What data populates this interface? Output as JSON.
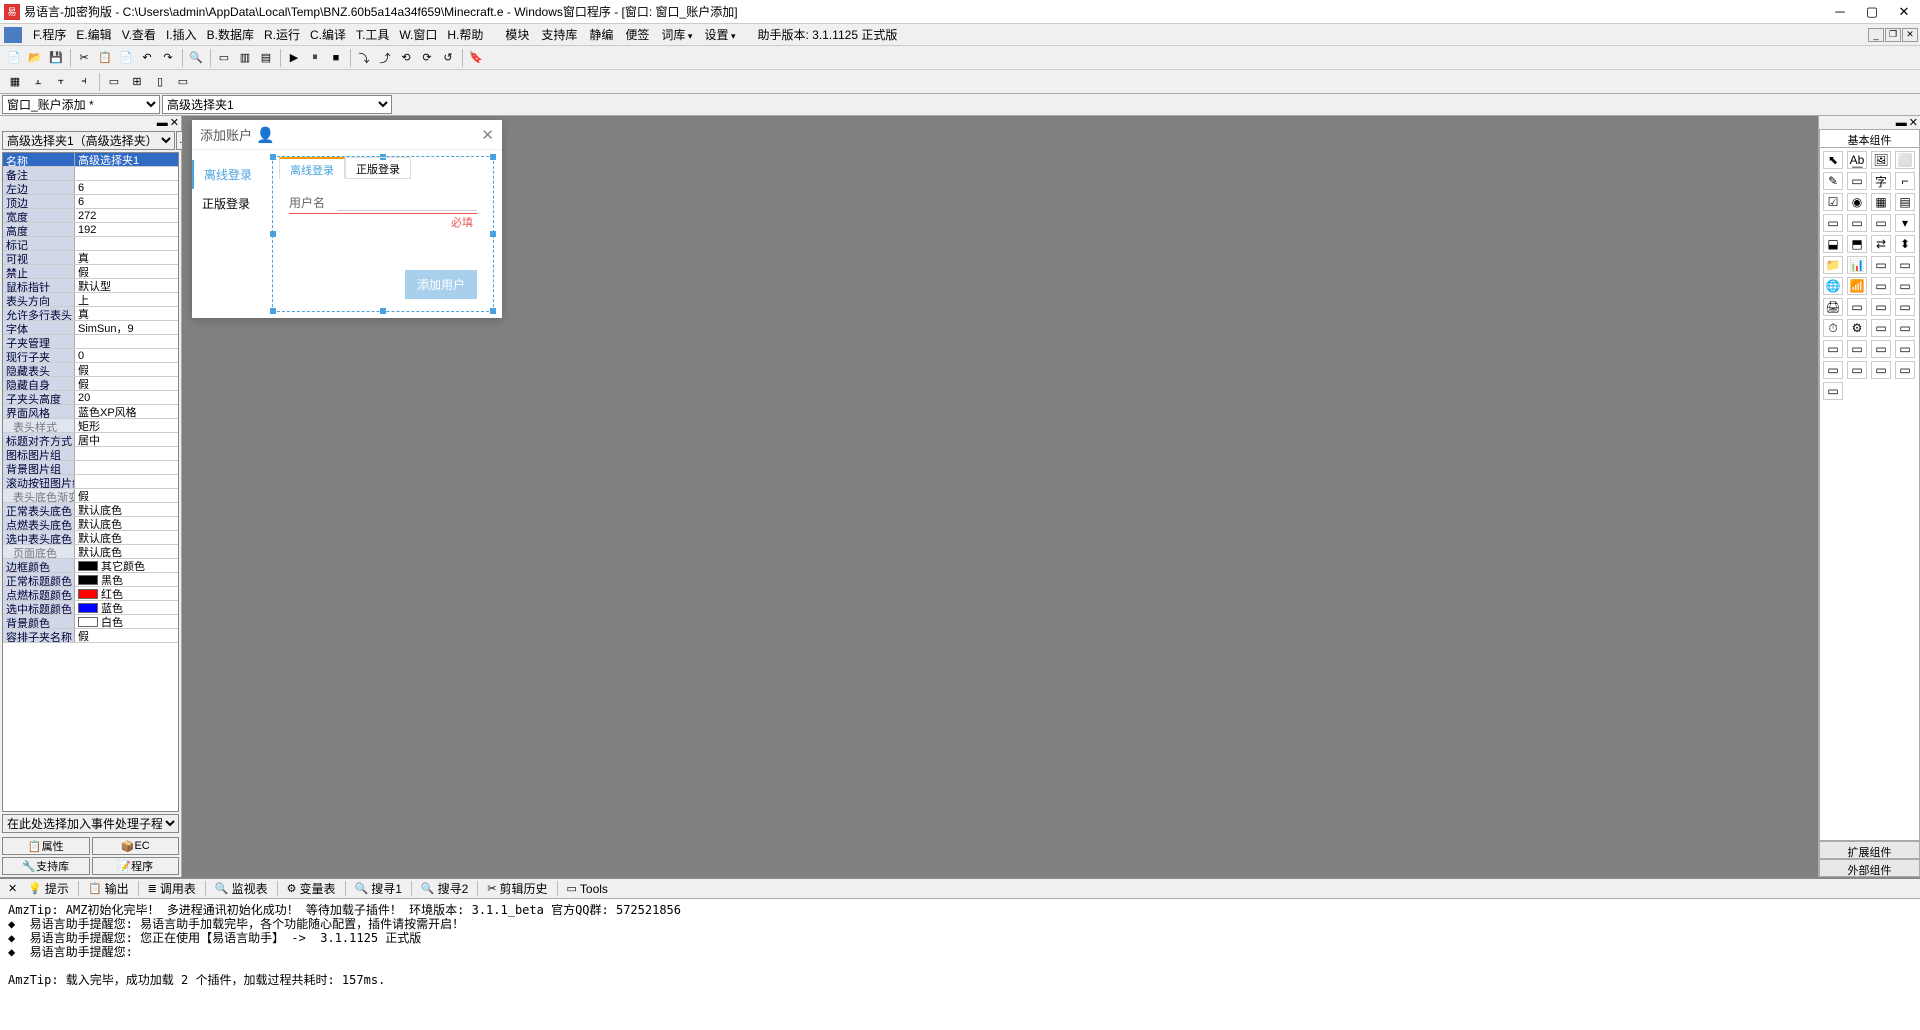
{
  "window": {
    "title": "易语言-加密狗版 - C:\\Users\\admin\\AppData\\Local\\Temp\\BNZ.60b5a14a34f659\\Minecraft.e - Windows窗口程序 - [窗口: 窗口_账户添加]"
  },
  "menu": {
    "items": [
      "F.程序",
      "E.编辑",
      "V.查看",
      "I.插入",
      "B.数据库",
      "R.运行",
      "C.编译",
      "T.工具",
      "W.窗口",
      "H.帮助"
    ],
    "items2": [
      "模块",
      "支持库",
      "静编",
      "便签",
      "词库",
      "设置"
    ],
    "helper_version": "助手版本: 3.1.1125 正式版"
  },
  "combo": {
    "left": "窗口_账户添加 *",
    "right": "高级选择夹1"
  },
  "props": {
    "selector": "高级选择夹1（高级选择夹）",
    "rows": [
      {
        "k": "名称",
        "v": "高级选择夹1",
        "sel": true
      },
      {
        "k": "备注",
        "v": ""
      },
      {
        "k": "左边",
        "v": "6"
      },
      {
        "k": "顶边",
        "v": "6"
      },
      {
        "k": "宽度",
        "v": "272"
      },
      {
        "k": "高度",
        "v": "192"
      },
      {
        "k": "标记",
        "v": ""
      },
      {
        "k": "可视",
        "v": "真"
      },
      {
        "k": "禁止",
        "v": "假"
      },
      {
        "k": "鼠标指针",
        "v": "默认型"
      },
      {
        "k": "表头方向",
        "v": "上"
      },
      {
        "k": "允许多行表头",
        "v": "真"
      },
      {
        "k": "字体",
        "v": "SimSun，9"
      },
      {
        "k": "子夹管理",
        "v": ""
      },
      {
        "k": "现行子夹",
        "v": "0"
      },
      {
        "k": "隐藏表头",
        "v": "假"
      },
      {
        "k": "隐藏自身",
        "v": "假"
      },
      {
        "k": "子夹头高度",
        "v": "20"
      },
      {
        "k": "界面风格",
        "v": "蓝色XP风格"
      },
      {
        "k": "表头样式",
        "v": "矩形",
        "sub": true
      },
      {
        "k": "标题对齐方式",
        "v": "居中"
      },
      {
        "k": "图标图片组",
        "v": ""
      },
      {
        "k": "背景图片组",
        "v": ""
      },
      {
        "k": "滚动按钮图片组",
        "v": ""
      },
      {
        "k": "表头底色渐变",
        "v": "假",
        "sub": true
      },
      {
        "k": "正常表头底色",
        "v": "默认底色"
      },
      {
        "k": "点燃表头底色",
        "v": "默认底色"
      },
      {
        "k": "选中表头底色",
        "v": "默认底色"
      },
      {
        "k": "页面底色",
        "v": "默认底色",
        "sub": true
      },
      {
        "k": "边框颜色",
        "v": "其它颜色",
        "color": "#000000"
      },
      {
        "k": "正常标题颜色",
        "v": "黑色",
        "color": "#000000"
      },
      {
        "k": "点燃标题颜色",
        "v": "红色",
        "color": "#ff0000"
      },
      {
        "k": "选中标题颜色",
        "v": "蓝色",
        "color": "#0000ff"
      },
      {
        "k": "背景颜色",
        "v": "白色",
        "color": "#ffffff"
      },
      {
        "k": "容排子夹名称",
        "v": "假"
      }
    ],
    "event_combo": "在此处选择加入事件处理子程序",
    "btn_attr": "属性",
    "btn_ec": "EC",
    "btn_support": "支持库",
    "btn_code": "程序"
  },
  "designer": {
    "title": "添加账户",
    "left_tabs": [
      "离线登录",
      "正版登录"
    ],
    "inner_tabs": [
      "离线登录",
      "正版登录"
    ],
    "field_label": "用户名",
    "required": "必填",
    "add_btn": "添加用户"
  },
  "component_tabs": {
    "basic": "基本组件",
    "ext": "扩展组件",
    "external": "外部组件"
  },
  "bottom": {
    "tabs": [
      {
        "icon": "💡",
        "label": "提示"
      },
      {
        "icon": "📋",
        "label": "输出"
      },
      {
        "icon": "≣",
        "label": "调用表"
      },
      {
        "icon": "🔍",
        "label": "监视表"
      },
      {
        "icon": "⚙",
        "label": "变量表"
      },
      {
        "icon": "🔍",
        "label": "搜寻1"
      },
      {
        "icon": "🔍",
        "label": "搜寻2"
      },
      {
        "icon": "✂",
        "label": "剪辑历史"
      },
      {
        "icon": "▭",
        "label": "Tools"
      }
    ],
    "content": "AmzTip: AMZ初始化完毕！ 多进程通讯初始化成功！ 等待加载子插件！ 环境版本: 3.1.1_beta 官方QQ群: 572521856\n◆  易语言助手提醒您: 易语言助手加载完毕，各个功能随心配置，插件请按需开启！\n◆  易语言助手提醒您: 您正在使用【易语言助手】 ->  3.1.1125 正式版\n◆  易语言助手提醒您:\n\nAmzTip: 载入完毕，成功加载 2 个插件，加载过程共耗时: 157ms."
  }
}
